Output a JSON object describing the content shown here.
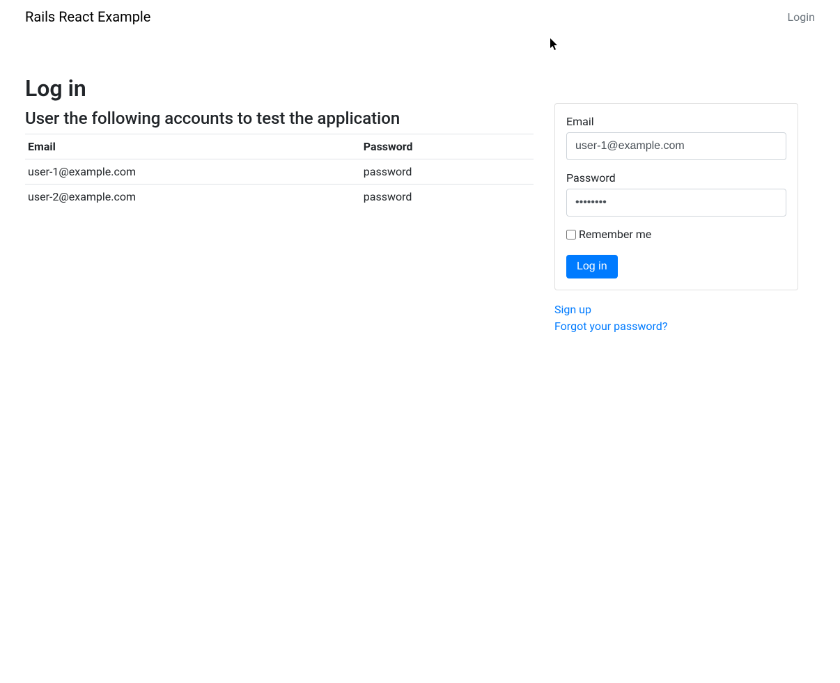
{
  "navbar": {
    "brand": "Rails React Example",
    "login_link": "Login"
  },
  "page": {
    "title": "Log in",
    "subtitle": "User the following accounts to test the application"
  },
  "accounts_table": {
    "headers": {
      "email": "Email",
      "password": "Password"
    },
    "rows": [
      {
        "email": "user-1@example.com",
        "password": "password"
      },
      {
        "email": "user-2@example.com",
        "password": "password"
      }
    ]
  },
  "form": {
    "email_label": "Email",
    "email_value": "user-1@example.com",
    "password_label": "Password",
    "password_value": "password",
    "remember_label": "Remember me",
    "submit_label": "Log in"
  },
  "links": {
    "signup": "Sign up",
    "forgot": "Forgot your password?"
  }
}
